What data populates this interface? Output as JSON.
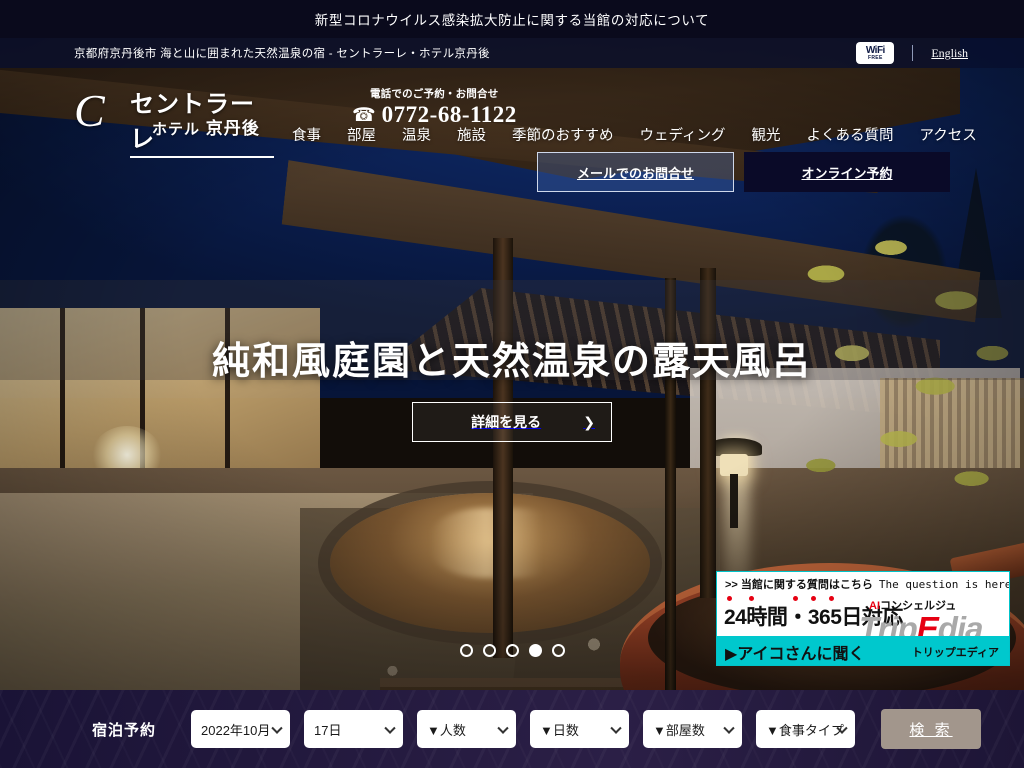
{
  "notice": {
    "text": "新型コロナウイルス感染拡大防止に関する当館の対応について"
  },
  "subheader": {
    "tagline": "京都府京丹後市 海と山に囲まれた天然温泉の宿 - セントラーレ・ホテル京丹後",
    "wifi_label": "WiFi",
    "wifi_sub": "FREE",
    "language_link": "English"
  },
  "logo": {
    "mark": "C",
    "kana": "セントラーレ",
    "sub_hotel": "ホテル",
    "sub_place": "京丹後"
  },
  "tel": {
    "label": "電話でのご予約・お問合せ",
    "icon": "phone-icon",
    "number": "0772-68-1122"
  },
  "header_buttons": {
    "mail": "メールでのお問合せ",
    "online": "オンライン予約"
  },
  "nav": {
    "items": [
      {
        "label": "食事",
        "name": "nav-item-dining"
      },
      {
        "label": "部屋",
        "name": "nav-item-rooms"
      },
      {
        "label": "温泉",
        "name": "nav-item-onsen"
      },
      {
        "label": "施設",
        "name": "nav-item-facilities"
      },
      {
        "label": "季節のおすすめ",
        "name": "nav-item-seasonal"
      },
      {
        "label": "ウェディング",
        "name": "nav-item-wedding"
      },
      {
        "label": "観光",
        "name": "nav-item-sightseeing"
      },
      {
        "label": "よくある質問",
        "name": "nav-item-faq"
      },
      {
        "label": "アクセス",
        "name": "nav-item-access"
      }
    ]
  },
  "hero": {
    "title": "純和風庭園と天然温泉の露天風呂",
    "cta_label": "詳細を見る",
    "cta_arrow": "❯",
    "dots_total": 5,
    "dots_active_index": 3
  },
  "ai_banner": {
    "question_jp": ">> 当館に関する質問はこちら",
    "question_en": "The question is here.",
    "availability": "24時間・365日対応",
    "concierge_label_ai": "AI",
    "concierge_label_rest": "コンシェルジュ",
    "brand_trip": "Trip",
    "brand_e": "E",
    "brand_dia": "dia",
    "brand_kana": "トリップエディア",
    "ask_button": "▶アイコさんに聞く"
  },
  "booking": {
    "label": "宿泊予約",
    "fields": [
      {
        "name": "booking-select-month",
        "value": "2022年10月"
      },
      {
        "name": "booking-select-day",
        "value": "17日"
      },
      {
        "name": "booking-select-guests",
        "value": "▼人数"
      },
      {
        "name": "booking-select-nights",
        "value": "▼日数"
      },
      {
        "name": "booking-select-rooms",
        "value": "▼部屋数"
      },
      {
        "name": "booking-select-mealtype",
        "value": "▼食事タイプ"
      }
    ],
    "search_label": "検 索"
  },
  "colors": {
    "notice_bg": "#0a0a1c",
    "header_dark": "#0a0a28",
    "accent_teal": "#00c8cd",
    "accent_red": "#e60012",
    "search_button": "#a2968c",
    "booking_bg": "#241a3f"
  }
}
